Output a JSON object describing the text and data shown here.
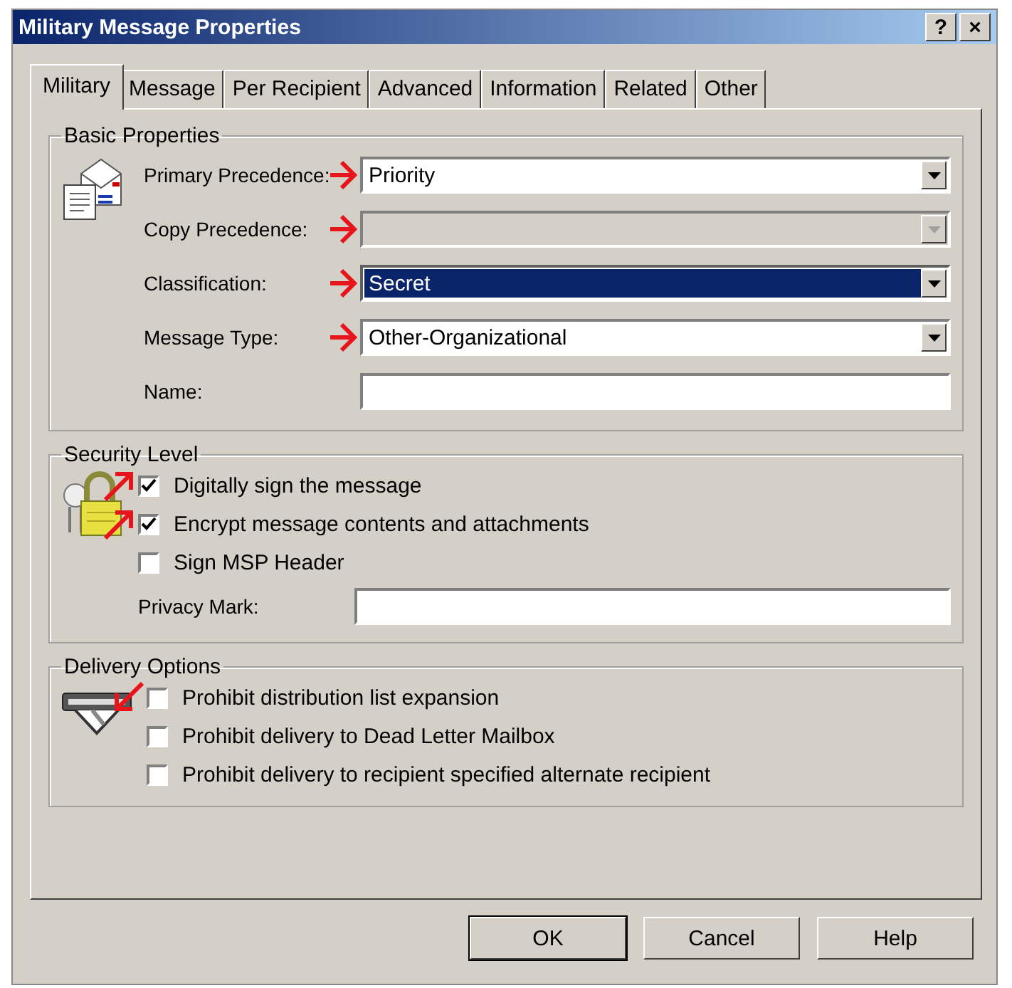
{
  "window": {
    "title": "Military Message Properties",
    "help_button": "?",
    "close_button": "×"
  },
  "tabs": [
    {
      "label": "Military",
      "selected": true
    },
    {
      "label": "Message",
      "selected": false
    },
    {
      "label": "Per Recipient",
      "selected": false
    },
    {
      "label": "Advanced",
      "selected": false
    },
    {
      "label": "Information",
      "selected": false
    },
    {
      "label": "Related",
      "selected": false
    },
    {
      "label": "Other",
      "selected": false
    }
  ],
  "basic_properties": {
    "title": "Basic Properties",
    "fields": [
      {
        "kind": "dropdown",
        "label": "Primary Precedence:",
        "value": "Priority",
        "disabled": false,
        "focused": false,
        "arrow": true
      },
      {
        "kind": "dropdown",
        "label": "Copy Precedence:",
        "disabled": true,
        "focused": false,
        "arrow": true
      },
      {
        "kind": "dropdown",
        "label": "Classification:",
        "value": "Secret",
        "disabled": false,
        "focused": true,
        "arrow": true
      },
      {
        "kind": "dropdown",
        "label": "Message Type:",
        "value": "Other-Organizational",
        "disabled": false,
        "focused": false,
        "arrow": true
      },
      {
        "kind": "text",
        "label": "Name:"
      }
    ]
  },
  "security_level": {
    "title": "Security Level",
    "options": [
      {
        "label": "Digitally sign the message",
        "checked": true,
        "arrow": true
      },
      {
        "label": "Encrypt message contents and attachments",
        "checked": true,
        "arrow": true
      },
      {
        "label": "Sign MSP Header",
        "checked": false,
        "arrow": false
      }
    ],
    "privacy_mark": {
      "label": "Privacy Mark:"
    }
  },
  "delivery_options": {
    "title": "Delivery Options",
    "options": [
      {
        "label": "Prohibit distribution list expansion",
        "checked": false,
        "arrow": true
      },
      {
        "label": "Prohibit delivery to Dead Letter Mailbox",
        "checked": false,
        "arrow": false
      },
      {
        "label": "Prohibit delivery to recipient specified alternate recipient",
        "checked": false,
        "arrow": false
      }
    ]
  },
  "buttons": [
    {
      "label": "OK",
      "default": true
    },
    {
      "label": "Cancel",
      "default": false
    },
    {
      "label": "Help",
      "default": false
    }
  ]
}
